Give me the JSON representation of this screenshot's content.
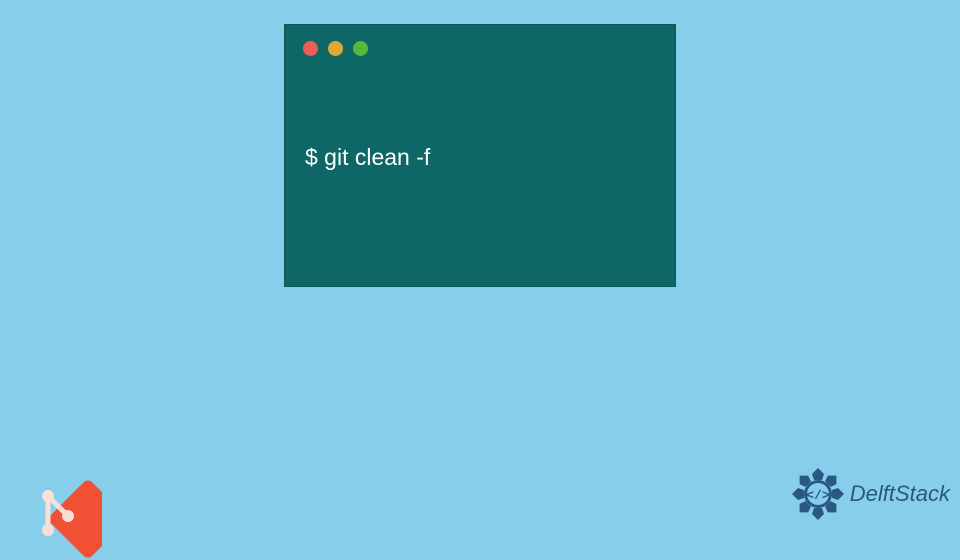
{
  "terminal": {
    "command": "$ git clean -f",
    "dots": {
      "red": "#ec5f59",
      "yellow": "#e1a735",
      "green": "#56b83d"
    }
  },
  "branding": {
    "delftstack_text": "DelftStack"
  }
}
